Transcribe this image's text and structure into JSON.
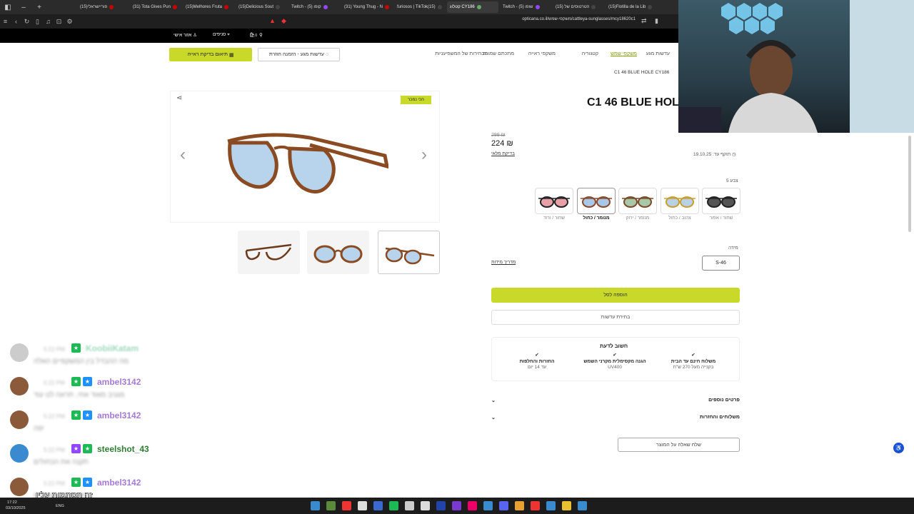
{
  "browser": {
    "tabs": [
      {
        "label": "(15)פוריישראלי",
        "fav": "#c00"
      },
      {
        "label": "(31) Tota Gives Pun",
        "fav": "#c00"
      },
      {
        "label": "(15)Melhores Fruta",
        "fav": "#c00"
      },
      {
        "label": "(15)Delicious Sout",
        "fav": "#444"
      },
      {
        "label": "Twitch - (5) קופו",
        "fav": "#9147ff"
      },
      {
        "label": "(31) Young Thug - N",
        "fav": "#c00"
      },
      {
        "label": "furiosos | TikTok(15)",
        "fav": "#444"
      },
      {
        "label": "קטלוג CY186",
        "fav": "#6a6",
        "active": true
      },
      {
        "label": "Twitch - שופו (5)",
        "fav": "#9147ff"
      },
      {
        "label": "הטרטוסים של (15)",
        "fav": "#444"
      },
      {
        "label": "(15)Flotilla de la Lib",
        "fav": "#444"
      }
    ],
    "url": "opticana.co.il/משקפי-שמש/cattleya-sunglasses/mcy18620c1"
  },
  "site_header": {
    "account": "אזור אישי",
    "stores": "סניפים",
    "cart_count": "0"
  },
  "nav": {
    "items": [
      "עדשות מגע",
      "משקפי שמש",
      "קטגוריה",
      "משקפי ראייה",
      "מתכתם שמונה",
      "הבחירות של המשפיעניות"
    ],
    "active_index": 1,
    "lens_button": "עדשות מגע - הזמנה חוזרת",
    "eye_exam_button": "תיאום בדיקת ראייה"
  },
  "breadcrumb": "C1 46 BLUE HOLE CY186",
  "product": {
    "badge": "הכי נמכר",
    "title": "C1 46 BLUE HOLE CY186",
    "old_price": "299 ₪",
    "price": "224 ₪",
    "full_check": "בדיקת מלאי",
    "validity": "תוקף עד: 19.10.25",
    "colors_count": "5 צבע",
    "colors": [
      {
        "label": "שחור / ורוד",
        "lens": "#e8a0a8",
        "frame": "#222"
      },
      {
        "label": "מנומר / כחול",
        "lens": "#a8c8e8",
        "frame": "#8a4a2a",
        "selected": true
      },
      {
        "label": "מנומר / ירוק",
        "lens": "#a8c8a8",
        "frame": "#7a4a2a"
      },
      {
        "label": "צהוב / כחול",
        "lens": "#b8d0e8",
        "frame": "#c8a030"
      },
      {
        "label": "שחור / אפור",
        "lens": "#555",
        "frame": "#222"
      }
    ],
    "size_label": "מידה",
    "size_value": "S-46",
    "size_guide": "מדריך מידות",
    "add_to_cart": "הוספה לסל",
    "choose_lenses": "בחירת עדשות",
    "info_title": "חשוב לדעת",
    "features": [
      {
        "title": "משלוח חינם עד הבית",
        "sub": "בקנייה מעל 270 ש\"ח"
      },
      {
        "title": "הגנה מקסימלית מקרני השמש",
        "sub": "UV400"
      },
      {
        "title": "החזרות והחלפות",
        "sub": "עד 14 יום"
      }
    ],
    "accordion": [
      "פרטים נוספים",
      "משלוחים והחזרות"
    ],
    "ask_button": "שלח שאלה על המוצר"
  },
  "chat": [
    {
      "name": "KoobiiKatam",
      "name_color": "#a0d8c0",
      "time": "5:22 PM",
      "msg": "מה ההבדל בין המשקפיים האלה",
      "avatar": "#ccc",
      "blurred_name": true,
      "badges": [
        "#1db954"
      ]
    },
    {
      "name": "ambel3142",
      "name_color": "#a67bd6",
      "time": "5:22 PM",
      "msg": "מגניב מאוד אחי, תראה לנו עוד",
      "avatar": "#8a5a3a",
      "badges": [
        "#1db954",
        "#1e90ff"
      ]
    },
    {
      "name": "ambel3142",
      "name_color": "#a67bd6",
      "time": "5:22 PM",
      "msg": "יפה",
      "avatar": "#8a5a3a",
      "badges": [
        "#1db954",
        "#1e90ff"
      ]
    },
    {
      "name": "steelshot_43",
      "name_color": "#2e7d32",
      "time": "5:22 PM",
      "msg": "תקנה את הכחולים",
      "avatar": "#3a8ad0",
      "badges": [
        "#9147ff",
        "#1db954"
      ]
    },
    {
      "name": "ambel3142",
      "name_color": "#a67bd6",
      "time": "5:22 PM",
      "msg": "משקפיים מגניבים",
      "avatar": "#8a5a3a",
      "badges": [
        "#1db954",
        "#1e90ff"
      ]
    }
  ],
  "overlay_text": "זה תסתמות עלין",
  "taskbar": {
    "time": "17:22",
    "date": "03/10/2025",
    "lang": "ENG"
  }
}
